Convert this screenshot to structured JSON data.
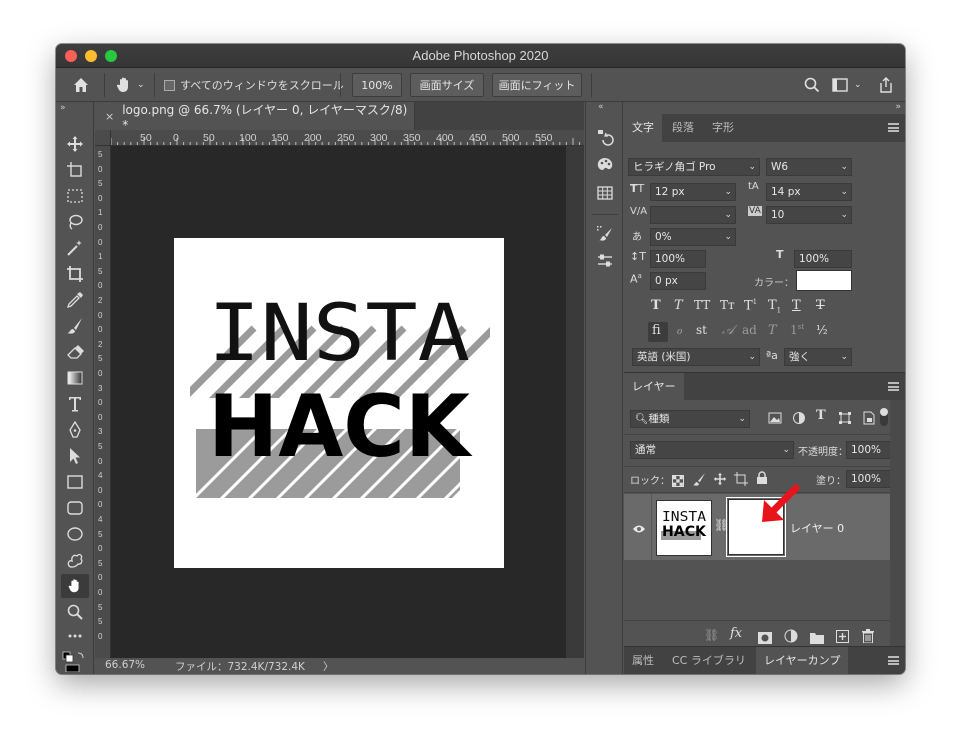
{
  "window": {
    "title": "Adobe Photoshop 2020"
  },
  "options_bar": {
    "scroll_all_label": "すべてのウィンドウをスクロール",
    "zoom_100": "100%",
    "fit_screen": "画面サイズ",
    "fit_window": "画面にフィット"
  },
  "document": {
    "tab_title": "logo.png @ 66.7% (レイヤー 0, レイヤーマスク/8) *",
    "tab_close": "×",
    "ruler_top": [
      "50",
      "0",
      "50",
      "100",
      "150",
      "200",
      "250",
      "300",
      "350",
      "400",
      "450",
      "500",
      "550"
    ],
    "ruler_left": [
      "5",
      "0",
      "5",
      "0",
      "1",
      "0",
      "0",
      "1",
      "5",
      "0",
      "2",
      "0",
      "0",
      "2",
      "5",
      "0",
      "3",
      "0",
      "0",
      "3",
      "5",
      "0",
      "4",
      "0",
      "0",
      "4",
      "5",
      "0",
      "5",
      "0",
      "0",
      "5",
      "5",
      "0"
    ],
    "logo_line1": "INSTA",
    "logo_line2": "HACK"
  },
  "status_bar": {
    "zoom": "66.67%",
    "file_info": "ファイル：732.4K/732.4K",
    "arrow": "〉"
  },
  "character_panel": {
    "tabs": [
      "文字",
      "段落",
      "字形"
    ],
    "font_family": "ヒラギノ角ゴ Pro",
    "font_weight": "W6",
    "font_size": "12 px",
    "leading": "14 px",
    "kerning": "",
    "tracking": "10",
    "tsume": "0%",
    "vertical_scale": "100%",
    "horizontal_scale": "100%",
    "baseline_shift": "0 px",
    "color_label": "カラー：",
    "language": "英語 (米国)",
    "antialias": "強く",
    "aa_label": "ªa"
  },
  "layers_panel": {
    "title": "レイヤー",
    "filter_kind": "種類",
    "blend_mode": "通常",
    "opacity_label": "不透明度：",
    "opacity_value": "100%",
    "lock_label": "ロック：",
    "fill_label": "塗り：",
    "fill_value": "100%",
    "layer_name": "レイヤー 0",
    "thumb_line1": "INSTA",
    "thumb_line2": "HACK"
  },
  "bottom_tabs": [
    "属性",
    "CC ライブラリ",
    "レイヤーカンプ"
  ],
  "colors": {
    "arrow_red": "#e8141b",
    "panel_bg": "#535353",
    "canvas_bg": "#282828"
  }
}
